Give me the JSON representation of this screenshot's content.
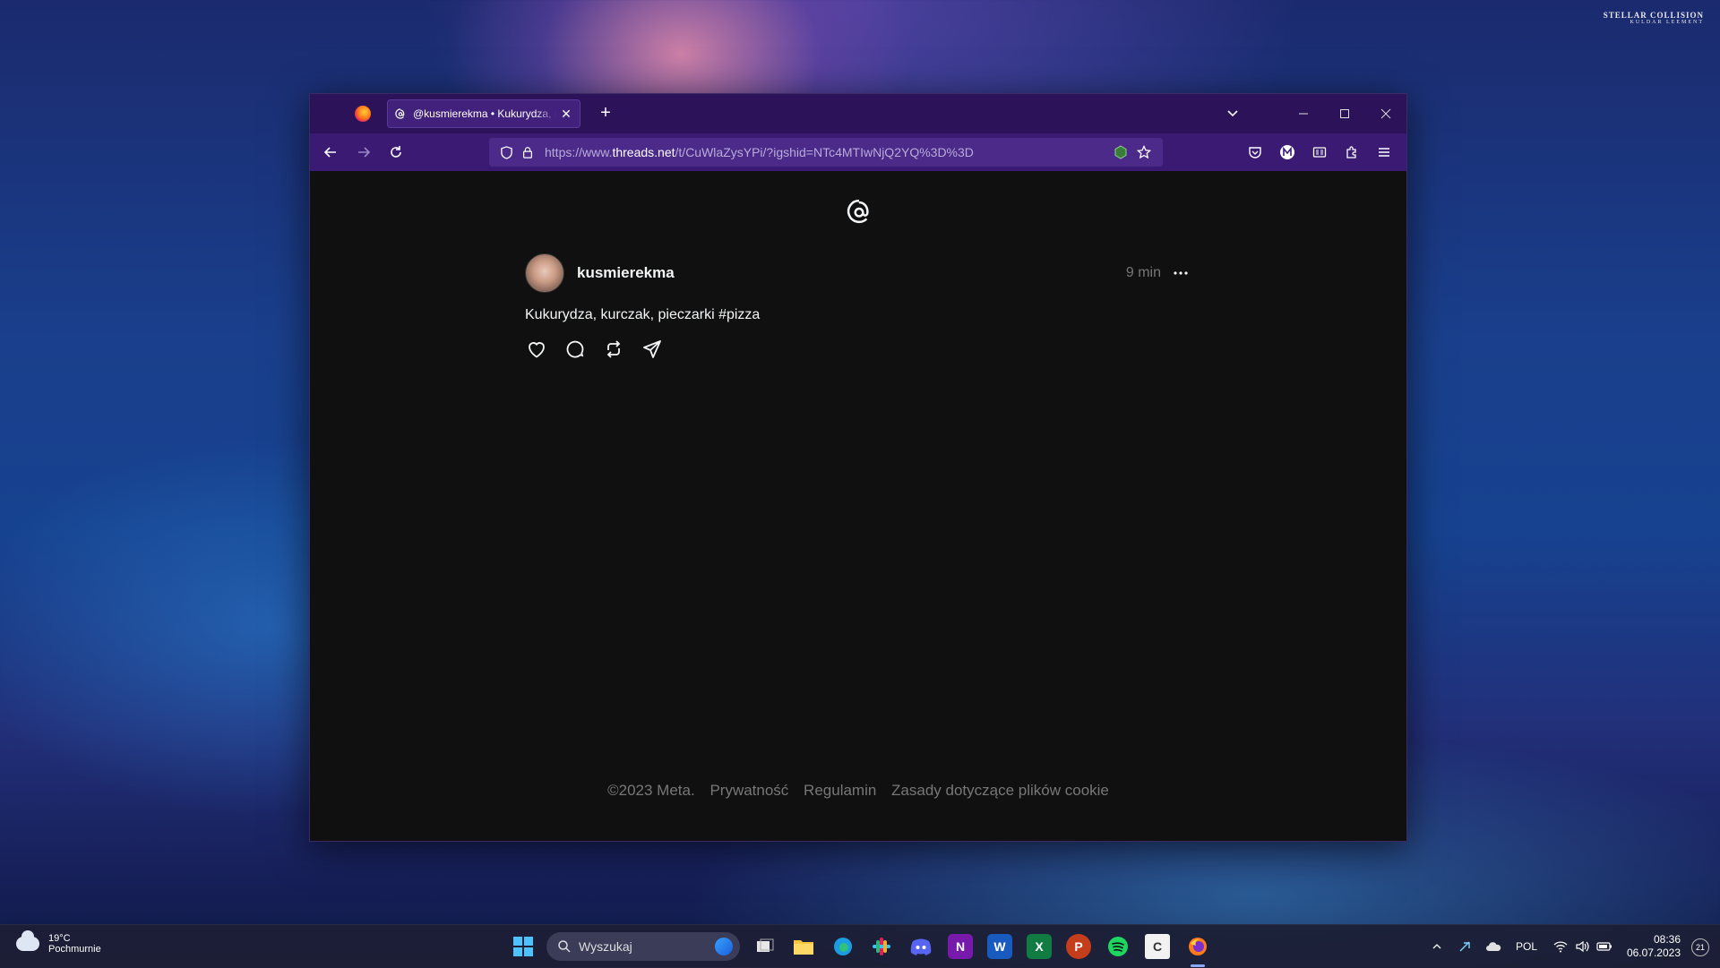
{
  "wallpaper": {
    "credit_line1": "STELLAR COLLISION",
    "credit_line2": "KULDAR LEEMENT"
  },
  "browser": {
    "tab": {
      "title": "@kusmierekma • Kukurydza, kurczak, pieczarki #pizza",
      "close": "✕"
    },
    "new_tab": "+",
    "url": {
      "prefix": "https://www.",
      "domain": "threads.net",
      "path": "/t/CuWlaZysYPi/?igshid=NTc4MTIwNjQ2YQ%3D%3D"
    }
  },
  "post": {
    "username": "kusmierekma",
    "time": "9 min",
    "text": "Kukurydza, kurczak, pieczarki #pizza"
  },
  "footer": {
    "copyright": "©2023 Meta.",
    "privacy": "Prywatność",
    "terms": "Regulamin",
    "cookies": "Zasady dotyczące plików cookie"
  },
  "taskbar": {
    "weather": {
      "temp": "19°C",
      "condition": "Pochmurnie"
    },
    "search_placeholder": "Wyszukaj",
    "language": "POL",
    "time": "08:36",
    "date": "06.07.2023",
    "notifications": "21"
  },
  "colors": {
    "tabbar": "#2b1259",
    "navbar": "#3a1a72",
    "page_bg": "#101010",
    "taskbar": "#1c1e34"
  }
}
